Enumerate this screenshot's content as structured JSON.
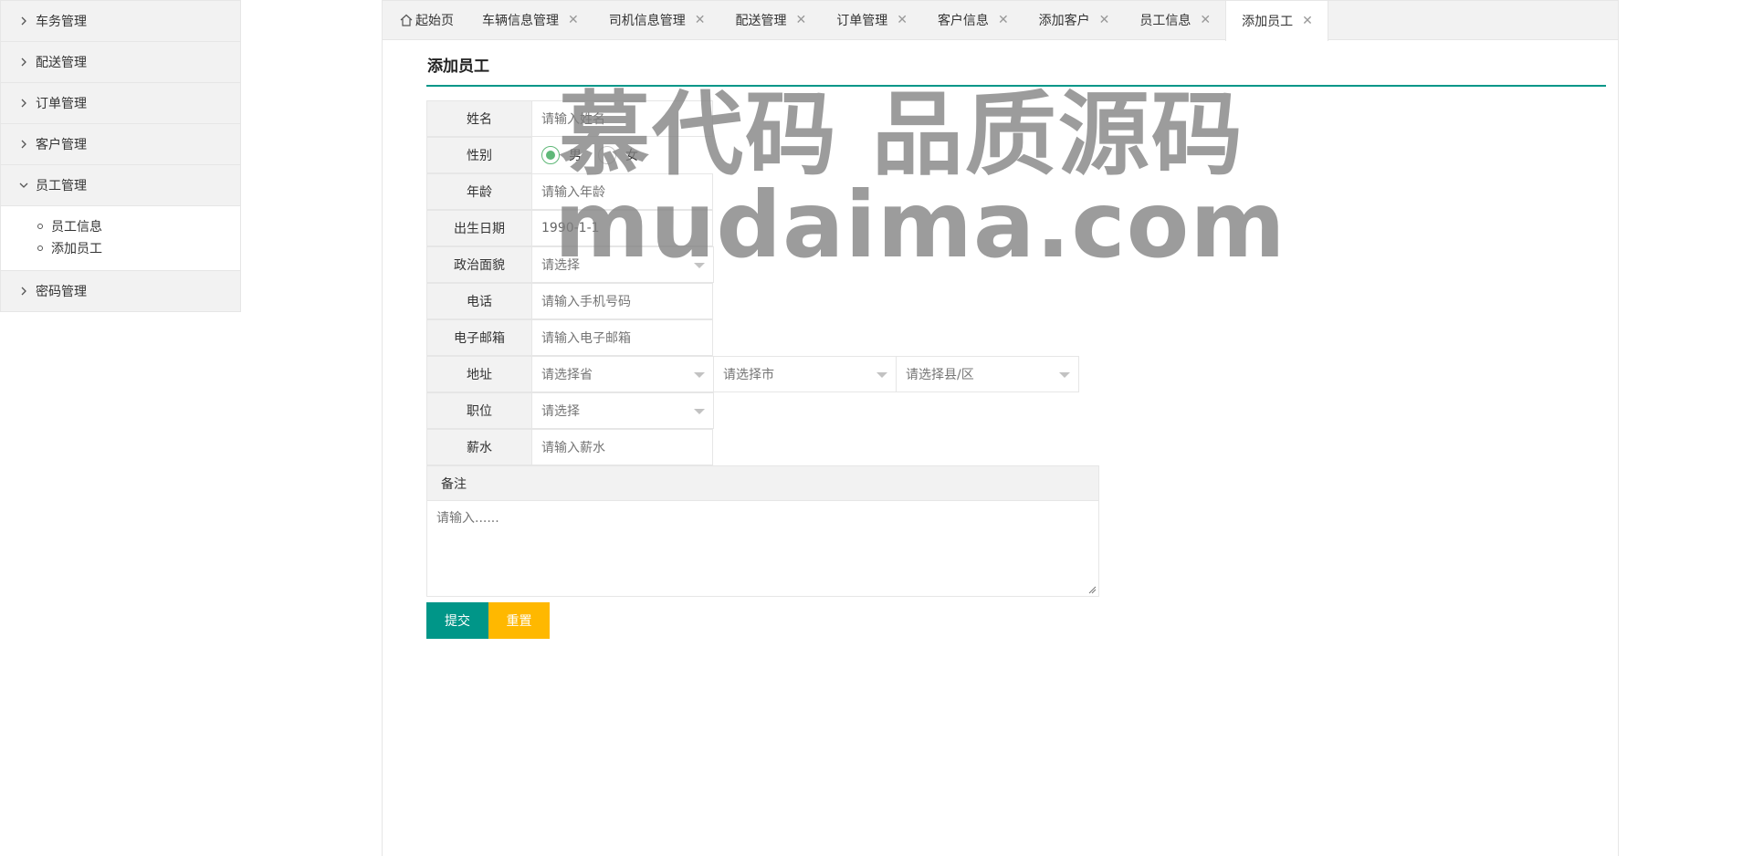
{
  "sidebar": {
    "items": [
      {
        "label": "车务管理"
      },
      {
        "label": "配送管理"
      },
      {
        "label": "订单管理"
      },
      {
        "label": "客户管理"
      },
      {
        "label": "员工管理",
        "expanded": true,
        "children": [
          {
            "label": "员工信息"
          },
          {
            "label": "添加员工"
          }
        ]
      },
      {
        "label": "密码管理"
      }
    ]
  },
  "tabs": [
    {
      "label": "起始页",
      "closable": false
    },
    {
      "label": "车辆信息管理",
      "closable": true
    },
    {
      "label": "司机信息管理",
      "closable": true
    },
    {
      "label": "配送管理",
      "closable": true
    },
    {
      "label": "订单管理",
      "closable": true
    },
    {
      "label": "客户信息",
      "closable": true
    },
    {
      "label": "添加客户",
      "closable": true
    },
    {
      "label": "员工信息",
      "closable": true
    },
    {
      "label": "添加员工",
      "closable": true,
      "active": true
    }
  ],
  "page": {
    "title": "添加员工"
  },
  "form": {
    "name": {
      "label": "姓名",
      "placeholder": "请输入姓名"
    },
    "gender": {
      "label": "性别",
      "options": [
        {
          "label": "男",
          "checked": true
        },
        {
          "label": "女",
          "checked": false
        }
      ]
    },
    "age": {
      "label": "年龄",
      "placeholder": "请输入年龄"
    },
    "birth": {
      "label": "出生日期",
      "value": "1990-1-1"
    },
    "politics": {
      "label": "政治面貌",
      "placeholder": "请选择"
    },
    "phone": {
      "label": "电话",
      "placeholder": "请输入手机号码"
    },
    "email": {
      "label": "电子邮箱",
      "placeholder": "请输入电子邮箱"
    },
    "address": {
      "label": "地址",
      "province": "请选择省",
      "city": "请选择市",
      "county": "请选择县/区"
    },
    "position": {
      "label": "职位",
      "placeholder": "请选择"
    },
    "salary": {
      "label": "薪水",
      "placeholder": "请输入薪水"
    },
    "remark": {
      "label": "备注",
      "placeholder": "请输入......"
    }
  },
  "buttons": {
    "submit": "提交",
    "reset": "重置"
  },
  "watermark": {
    "line1": "慕代码 品质源码",
    "line2": "mudaima.com"
  },
  "colors": {
    "primary": "#009688",
    "warm": "#ffb800",
    "radio": "#5fb878"
  },
  "icons": {
    "chevron_right": "chevron-right-icon",
    "chevron_down": "chevron-down-icon",
    "home": "home-icon",
    "close": "close-icon"
  }
}
